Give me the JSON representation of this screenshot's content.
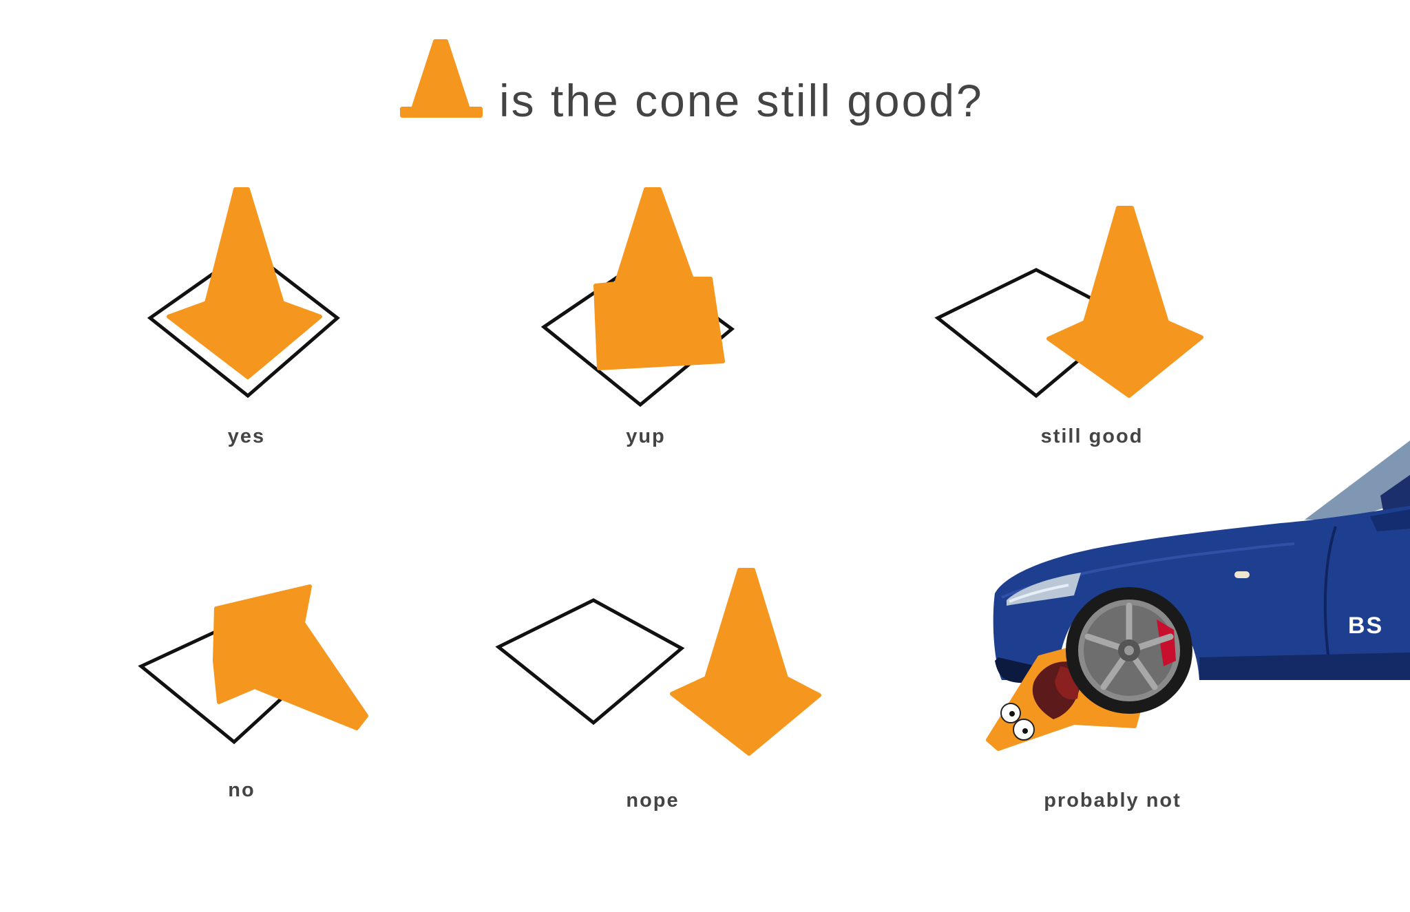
{
  "title": "is the cone still good?",
  "panels": [
    {
      "label": "yes"
    },
    {
      "label": "yup"
    },
    {
      "label": "still good"
    },
    {
      "label": "no"
    },
    {
      "label": "nope"
    },
    {
      "label": "probably not"
    }
  ],
  "car": {
    "door_text": "BS"
  },
  "colors": {
    "cone": "#F5961F",
    "outline": "#111111",
    "text": "#444444",
    "car_body": "#1E3F8F",
    "tire": "#1a1a1a",
    "rim": "#8a8a8a",
    "brake_caliper": "#c8102e"
  },
  "icons": [
    "cone-icon",
    "base-square-outline",
    "sports-car",
    "squashed-cone-face"
  ]
}
